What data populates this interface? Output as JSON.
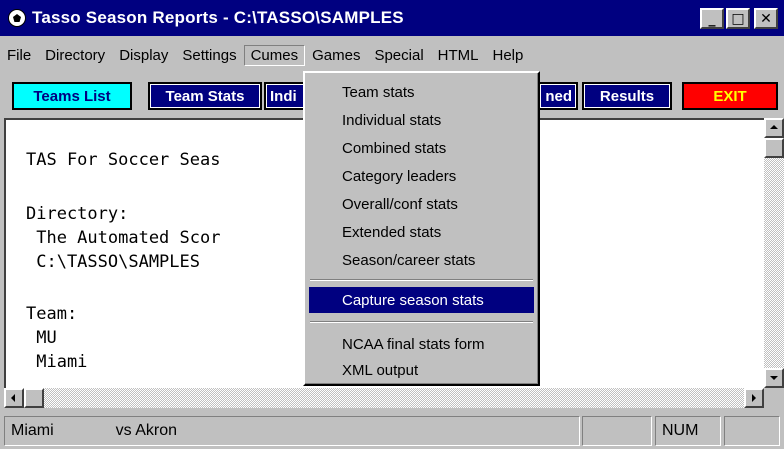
{
  "window": {
    "title": "Tasso Season Reports - C:\\TASSO\\SAMPLES",
    "controls": [
      "_",
      "□",
      "✕"
    ]
  },
  "menubar": {
    "items": [
      "File",
      "Directory",
      "Display",
      "Settings",
      "Cumes",
      "Games",
      "Special",
      "HTML",
      "Help"
    ],
    "active": "Cumes"
  },
  "toolbar": {
    "teams_list": "Teams List",
    "team_stats": "Team Stats",
    "individual": "Indi",
    "combined": "ned",
    "results": "Results",
    "exit": "EXIT"
  },
  "content": {
    "lines": [
      "TAS For Soccer Seas",
      "Directory:",
      " The Automated Scor",
      " C:\\TASSO\\SAMPLES",
      "Team:",
      " MU",
      " Miami"
    ]
  },
  "cumes_menu": {
    "items": [
      "Team stats",
      "Individual stats",
      "Combined stats",
      "Category leaders",
      "Overall/conf stats",
      "Extended stats",
      "Season/career stats",
      "Capture season stats",
      "NCAA final stats form",
      "XML output"
    ],
    "selected": "Capture season stats"
  },
  "statusbar": {
    "team": "Miami",
    "game": "vs Akron",
    "num": "NUM"
  },
  "colors": {
    "titlebar": "#000080",
    "menu_highlight": "#000080",
    "button_cyan": "#00ffff",
    "button_navy": "#000080",
    "button_exit": "#ff0000",
    "exit_text": "#ffff00"
  }
}
